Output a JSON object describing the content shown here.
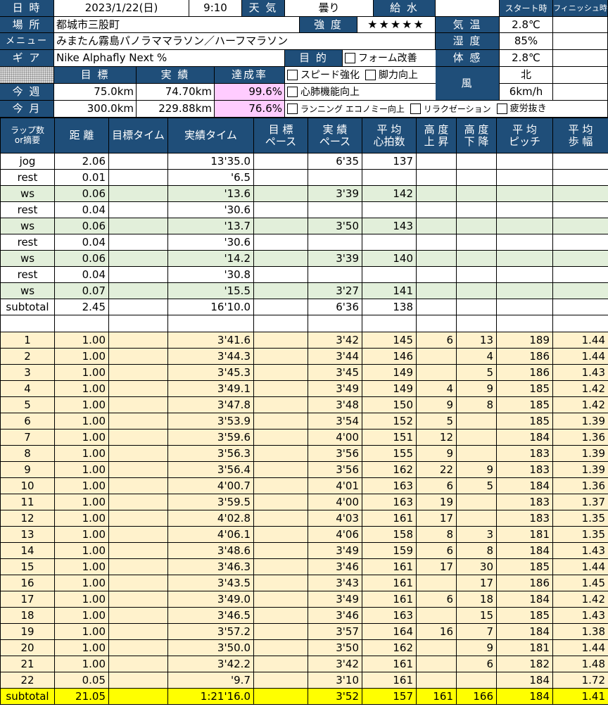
{
  "header": {
    "date_label": "日 時",
    "date_value": "2023/1/22(日)",
    "time_value": "9:10",
    "weather_label": "天 気",
    "weather_value": "曇り",
    "water_label": "給 水",
    "water_value": "",
    "start_time_label": "スタート時",
    "finish_time_label": "フィニッシュ時",
    "place_label": "場 所",
    "place_value": "都城市三股町",
    "intensity_label": "強 度",
    "intensity_value": "★★★★★",
    "temp_label": "気 温",
    "temp_value": "2.8℃",
    "menu_label": "メニュー",
    "menu_value": "みまたん霧島パノラママラソン／ハーフマラソン",
    "humidity_label": "湿 度",
    "humidity_value": "85%",
    "gear_label": "ギ ア",
    "gear_value": "Nike Alphafly Next %",
    "purpose_label": "目 的",
    "feel_label": "体 感",
    "feel_value": "2.8℃",
    "wind_label": "風",
    "wind_dir": "北",
    "wind_speed": "6km/h",
    "purposes": {
      "form": "フォーム改善",
      "speed": "スピード強化",
      "leg": "脚力向上",
      "cardio": "心肺機能向上",
      "economy": "ランニング エコノミー向上",
      "relax": "リラクゼーション",
      "fatigue": "疲労抜き"
    },
    "goal_label": "目 標",
    "actual_label": "実 績",
    "rate_label": "達成率",
    "week_label": "今 週",
    "week_goal": "75.0km",
    "week_actual": "74.70km",
    "week_rate": "99.6%",
    "month_label": "今 月",
    "month_goal": "300.0km",
    "month_actual": "229.88km",
    "month_rate": "76.6%"
  },
  "table": {
    "headers": [
      "ラップ数\nor摘要",
      "距 離",
      "目標タイム",
      "実績タイム",
      "目 標\nペース",
      "実 績\nペース",
      "平 均\n心拍数",
      "高 度\n上 昇",
      "高 度\n下 降",
      "平 均\nピッチ",
      "平 均\n歩 幅"
    ],
    "warmup": [
      {
        "lbl": "jog",
        "dist": "2.06",
        "time": "13'35.0",
        "pace": "6'35",
        "hr": "137",
        "type": "plain"
      },
      {
        "lbl": "rest",
        "dist": "0.01",
        "time": "'6.5",
        "pace": "",
        "hr": "",
        "type": "plain"
      },
      {
        "lbl": "ws",
        "dist": "0.06",
        "time": "'13.6",
        "pace": "3'39",
        "hr": "142",
        "type": "ws"
      },
      {
        "lbl": "rest",
        "dist": "0.04",
        "time": "'30.6",
        "pace": "",
        "hr": "",
        "type": "plain"
      },
      {
        "lbl": "ws",
        "dist": "0.06",
        "time": "'13.7",
        "pace": "3'50",
        "hr": "143",
        "type": "ws"
      },
      {
        "lbl": "rest",
        "dist": "0.04",
        "time": "'30.6",
        "pace": "",
        "hr": "",
        "type": "plain"
      },
      {
        "lbl": "ws",
        "dist": "0.06",
        "time": "'14.2",
        "pace": "3'39",
        "hr": "140",
        "type": "ws"
      },
      {
        "lbl": "rest",
        "dist": "0.04",
        "time": "'30.8",
        "pace": "",
        "hr": "",
        "type": "plain"
      },
      {
        "lbl": "ws",
        "dist": "0.07",
        "time": "'15.5",
        "pace": "3'27",
        "hr": "141",
        "type": "ws"
      },
      {
        "lbl": "subtotal",
        "dist": "2.45",
        "time": "16'10.0",
        "pace": "6'36",
        "hr": "138",
        "type": "plain"
      }
    ],
    "laps": [
      [
        "1",
        "1.00",
        "3'41.6",
        "3'42",
        "145",
        "6",
        "13",
        "189",
        "1.44"
      ],
      [
        "2",
        "1.00",
        "3'44.3",
        "3'44",
        "146",
        "",
        "4",
        "186",
        "1.44"
      ],
      [
        "3",
        "1.00",
        "3'45.3",
        "3'45",
        "149",
        "",
        "5",
        "186",
        "1.43"
      ],
      [
        "4",
        "1.00",
        "3'49.1",
        "3'49",
        "149",
        "4",
        "9",
        "185",
        "1.42"
      ],
      [
        "5",
        "1.00",
        "3'47.8",
        "3'48",
        "150",
        "9",
        "8",
        "185",
        "1.42"
      ],
      [
        "6",
        "1.00",
        "3'53.9",
        "3'54",
        "152",
        "5",
        "",
        "185",
        "1.39"
      ],
      [
        "7",
        "1.00",
        "3'59.6",
        "4'00",
        "151",
        "12",
        "",
        "184",
        "1.36"
      ],
      [
        "8",
        "1.00",
        "3'56.3",
        "3'56",
        "155",
        "9",
        "",
        "183",
        "1.39"
      ],
      [
        "9",
        "1.00",
        "3'56.4",
        "3'56",
        "162",
        "22",
        "9",
        "183",
        "1.39"
      ],
      [
        "10",
        "1.00",
        "4'00.7",
        "4'01",
        "163",
        "6",
        "5",
        "184",
        "1.36"
      ],
      [
        "11",
        "1.00",
        "3'59.5",
        "4'00",
        "163",
        "19",
        "",
        "183",
        "1.37"
      ],
      [
        "12",
        "1.00",
        "4'02.8",
        "4'03",
        "161",
        "17",
        "",
        "183",
        "1.35"
      ],
      [
        "13",
        "1.00",
        "4'06.1",
        "4'06",
        "158",
        "8",
        "3",
        "181",
        "1.35"
      ],
      [
        "14",
        "1.00",
        "3'48.6",
        "3'49",
        "159",
        "6",
        "8",
        "184",
        "1.43"
      ],
      [
        "15",
        "1.00",
        "3'46.3",
        "3'46",
        "161",
        "17",
        "30",
        "185",
        "1.44"
      ],
      [
        "16",
        "1.00",
        "3'43.5",
        "3'43",
        "161",
        "",
        "17",
        "186",
        "1.45"
      ],
      [
        "17",
        "1.00",
        "3'49.0",
        "3'49",
        "161",
        "6",
        "18",
        "184",
        "1.42"
      ],
      [
        "18",
        "1.00",
        "3'46.5",
        "3'46",
        "163",
        "",
        "15",
        "185",
        "1.43"
      ],
      [
        "19",
        "1.00",
        "3'57.2",
        "3'57",
        "164",
        "16",
        "7",
        "184",
        "1.38"
      ],
      [
        "20",
        "1.00",
        "3'50.0",
        "3'50",
        "162",
        "",
        "9",
        "181",
        "1.44"
      ],
      [
        "21",
        "1.00",
        "3'42.2",
        "3'42",
        "161",
        "",
        "6",
        "182",
        "1.48"
      ],
      [
        "22",
        "0.05",
        "'9.7",
        "3'10",
        "161",
        "",
        "",
        "184",
        "1.72"
      ]
    ],
    "total": [
      "subtotal",
      "21.05",
      "1:21'16.0",
      "3'52",
      "157",
      "161",
      "166",
      "184",
      "1.41"
    ]
  }
}
